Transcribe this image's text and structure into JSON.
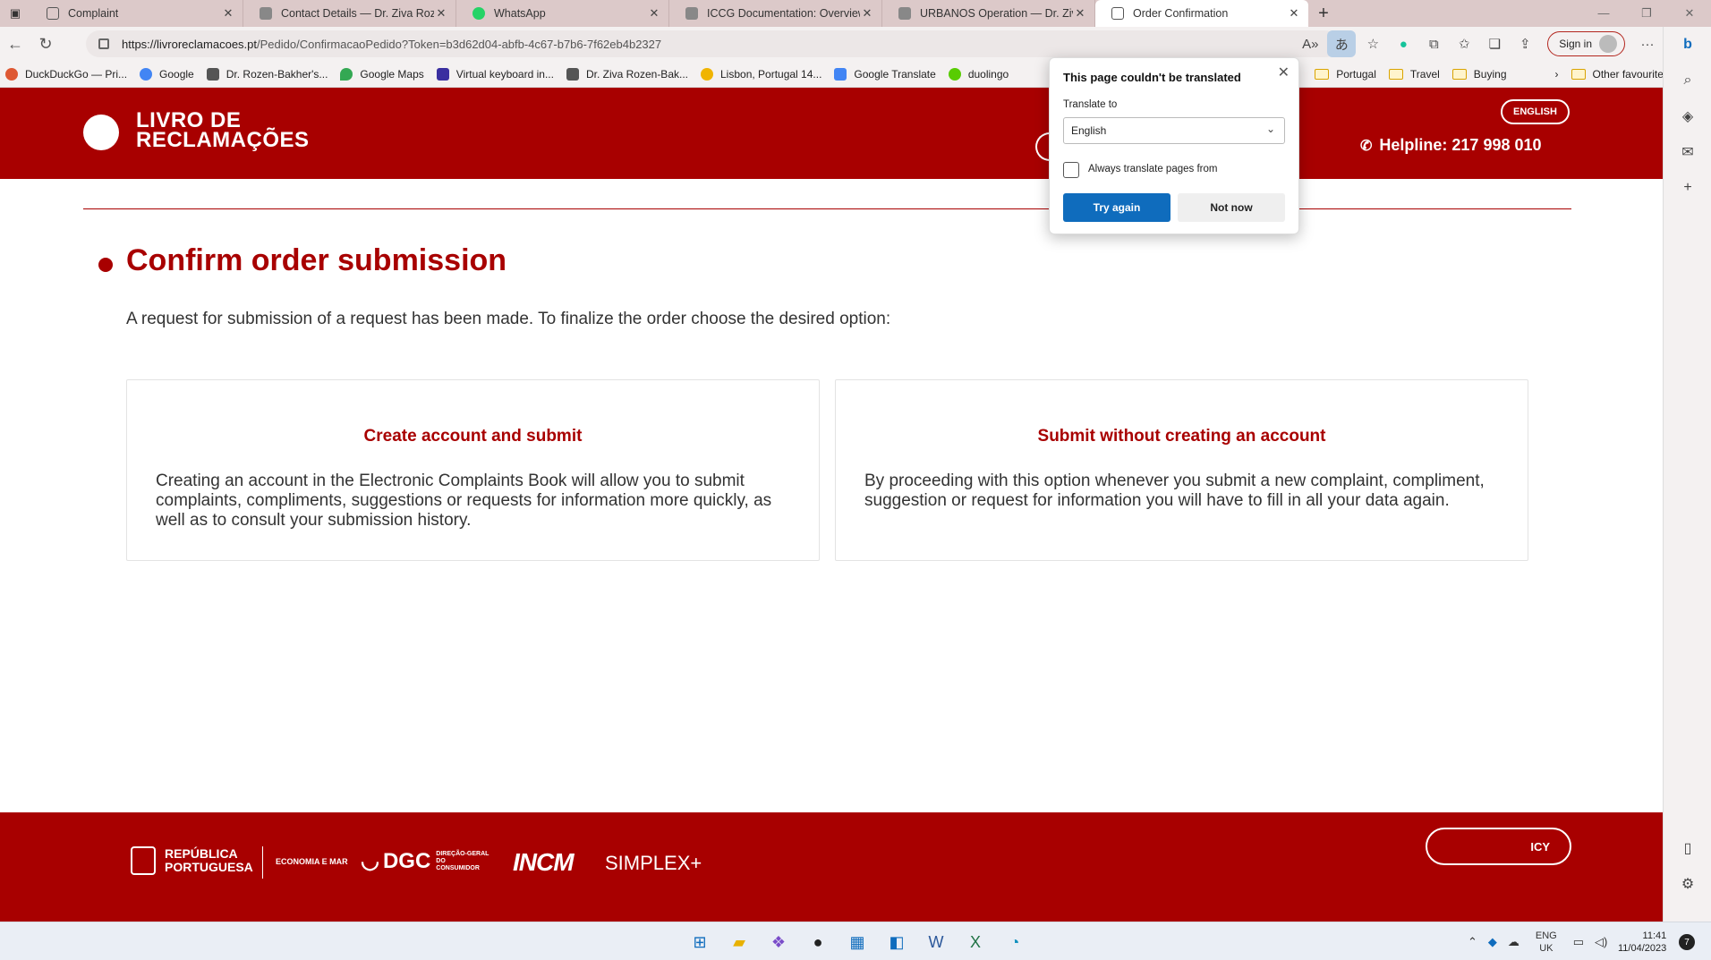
{
  "browser": {
    "tabs": [
      {
        "label": "Complaint",
        "icon": "page-icon",
        "active": false
      },
      {
        "label": "Contact Details — Dr. Ziva Rozen",
        "icon": "generic-site-icon",
        "active": false
      },
      {
        "label": "WhatsApp",
        "icon": "whatsapp-icon",
        "active": false
      },
      {
        "label": "ICCG Documentation: Overview a",
        "icon": "generic-site-icon",
        "active": false
      },
      {
        "label": "URBANOS Operation — Dr. Ziva",
        "icon": "generic-site-icon",
        "active": false
      },
      {
        "label": "Order Confirmation",
        "icon": "page-icon",
        "active": true
      }
    ],
    "close_glyph": "✕",
    "new_tab_glyph": "+",
    "url_host": "https://livroreclamacoes.pt",
    "url_path": "/Pedido/ConfirmacaoPedido?Token=b3d62d04-abfb-4c67-b7b6-7f62eb4b2327",
    "sign_in_label": "Sign in",
    "bookmarks": [
      {
        "label": "DuckDuckGo — Pri...",
        "color": "#de5833"
      },
      {
        "label": "Google",
        "color": "#4285f4"
      },
      {
        "label": "Dr. Rozen-Bakher's...",
        "color": "#555555"
      },
      {
        "label": "Google Maps",
        "color": "#34a853"
      },
      {
        "label": "Virtual keyboard in...",
        "color": "#3a2fa0"
      },
      {
        "label": "Dr. Ziva Rozen-Bak...",
        "color": "#555555"
      },
      {
        "label": "Lisbon, Portugal 14...",
        "color": "#f0b400"
      },
      {
        "label": "Google Translate",
        "color": "#4285f4"
      },
      {
        "label": "duolingo",
        "color": "#58cc02"
      }
    ],
    "bookmark_folders": [
      "Portugal",
      "Travel",
      "Buying"
    ],
    "other_favourites": "Other favourites"
  },
  "translate_popup": {
    "title": "This page couldn't be translated",
    "translate_to_label": "Translate to",
    "language_value": "English",
    "always_translate_label": "Always translate pages from",
    "try_again_label": "Try again",
    "not_now_label": "Not now"
  },
  "site": {
    "logo_line1": "LIVRO DE",
    "logo_line2": "RECLAMAÇÕES",
    "language_button": "ENGLISH",
    "helpline": "Helpline: 217 998 010",
    "page_title": "Confirm order submission",
    "intro": "A request for submission of a request has been made. To finalize the order choose the desired option:",
    "cards": [
      {
        "title": "Create account and submit",
        "body": "Creating an account in the Electronic Complaints Book will allow you to submit complaints, compliments, suggestions or requests for information more quickly, as well as to consult your submission history."
      },
      {
        "title": "Submit without creating an account",
        "body": "By proceeding with this option whenever you submit a new complaint, compliment, suggestion or request for information you will have to fill in all your data again."
      }
    ],
    "footer": {
      "republica_line1": "REPÚBLICA",
      "republica_line2": "PORTUGUESA",
      "economia": "ECONOMIA E MAR",
      "dgc": "DGC",
      "dgc_sub": "DIREÇÃO-GERAL DO CONSUMIDOR",
      "incm": "INCM",
      "simplex": "SIMPLEX+",
      "policy_button": "ICY"
    }
  },
  "taskbar": {
    "lang_line1": "ENG",
    "lang_line2": "UK",
    "time": "11:41",
    "date": "11/04/2023",
    "badge": "7"
  },
  "colors": {
    "brand_red": "#a80000",
    "accent_blue": "#0f6cbd"
  }
}
